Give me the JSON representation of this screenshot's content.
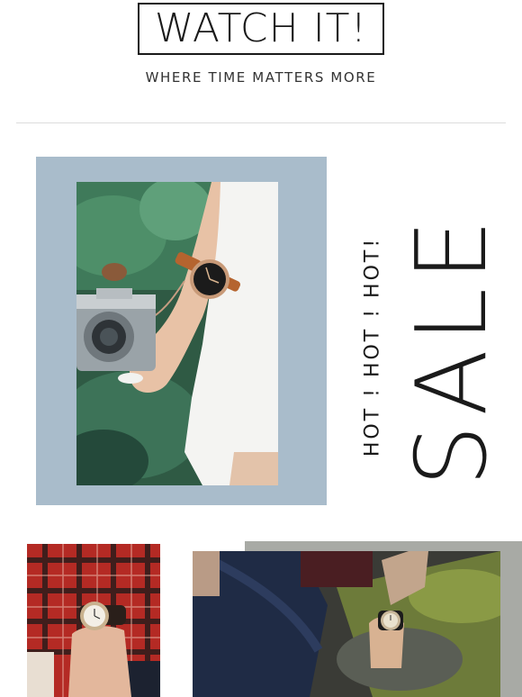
{
  "header": {
    "logo_text": "WATCH IT!",
    "tagline": "WHERE TIME MATTERS MORE"
  },
  "hero": {
    "subheading": "HOT ! HOT ! HOT!",
    "heading": "SALE",
    "frame_color": "#a9bccb"
  },
  "gallery": {
    "accent_color": "#a8aaa5"
  }
}
